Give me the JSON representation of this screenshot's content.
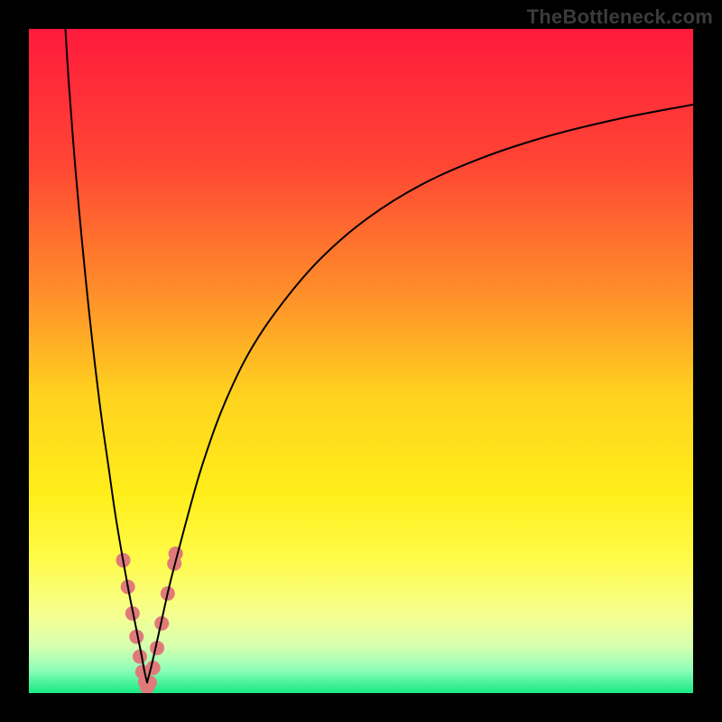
{
  "watermark": "TheBottleneck.com",
  "chart_data": {
    "type": "line",
    "title": "",
    "xlabel": "",
    "ylabel": "",
    "xlim": [
      0,
      100
    ],
    "ylim": [
      0,
      100
    ],
    "grid": false,
    "legend": false,
    "background_gradient": {
      "stops": [
        {
          "offset": 0.0,
          "color": "#ff1a3d"
        },
        {
          "offset": 0.2,
          "color": "#ff4534"
        },
        {
          "offset": 0.4,
          "color": "#ff8f2a"
        },
        {
          "offset": 0.55,
          "color": "#ffd21f"
        },
        {
          "offset": 0.7,
          "color": "#ffee1a"
        },
        {
          "offset": 0.8,
          "color": "#fffb4a"
        },
        {
          "offset": 0.88,
          "color": "#f6ff8e"
        },
        {
          "offset": 0.93,
          "color": "#d7ffb0"
        },
        {
          "offset": 0.965,
          "color": "#8effb8"
        },
        {
          "offset": 1.0,
          "color": "#17e884"
        }
      ]
    },
    "series": [
      {
        "name": "left-branch",
        "color": "#000000",
        "width": 2,
        "x": [
          5.5,
          6.0,
          7.0,
          8.0,
          9.0,
          10.0,
          11.0,
          12.0,
          13.0,
          14.0,
          15.0,
          15.8,
          16.5,
          17.0,
          17.4,
          17.8
        ],
        "y": [
          100,
          92,
          79,
          68,
          58,
          49,
          41,
          34,
          27,
          21,
          15.5,
          11.5,
          8.0,
          5.5,
          3.3,
          1.6
        ]
      },
      {
        "name": "right-branch",
        "color": "#000000",
        "width": 2,
        "x": [
          17.8,
          18.3,
          19.0,
          20.0,
          21.0,
          22.0,
          24.0,
          26.0,
          29.0,
          33.0,
          38.0,
          44.0,
          51.0,
          59.0,
          68.0,
          78.0,
          89.0,
          100.0
        ],
        "y": [
          1.6,
          3.5,
          6.5,
          11.0,
          15.5,
          19.5,
          27.0,
          34.0,
          42.5,
          51.0,
          58.5,
          65.5,
          71.5,
          76.5,
          80.5,
          83.8,
          86.5,
          88.6
        ]
      }
    ],
    "markers": {
      "name": "near-minimum-dots",
      "color": "#e07a7a",
      "radius": 8,
      "points": [
        {
          "x": 14.2,
          "y": 20.0
        },
        {
          "x": 14.9,
          "y": 16.0
        },
        {
          "x": 15.6,
          "y": 12.0
        },
        {
          "x": 16.2,
          "y": 8.5
        },
        {
          "x": 16.7,
          "y": 5.5
        },
        {
          "x": 17.1,
          "y": 3.2
        },
        {
          "x": 17.5,
          "y": 1.7
        },
        {
          "x": 17.8,
          "y": 0.9
        },
        {
          "x": 18.2,
          "y": 1.6
        },
        {
          "x": 18.7,
          "y": 3.8
        },
        {
          "x": 19.3,
          "y": 6.8
        },
        {
          "x": 20.0,
          "y": 10.5
        },
        {
          "x": 20.9,
          "y": 15.0
        },
        {
          "x": 21.9,
          "y": 19.5
        },
        {
          "x": 22.1,
          "y": 21.0
        }
      ]
    }
  }
}
